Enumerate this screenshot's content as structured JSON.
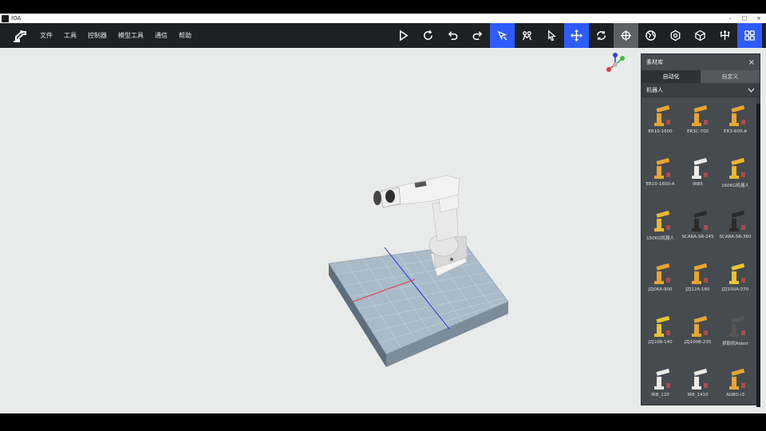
{
  "window": {
    "title": "IOA",
    "controls": [
      "–",
      "□",
      "×"
    ]
  },
  "menu": [
    "文件",
    "工具",
    "控制器",
    "模型工具",
    "通信",
    "帮助"
  ],
  "toolbar_icons": [
    "play-icon",
    "redo-circle-icon",
    "undo-icon",
    "redo-icon",
    "select-cursor-icon",
    "robot-arm-icon",
    "pointer-icon",
    "move-icon",
    "rotate-icon",
    "crosshair-icon",
    "globe-icon",
    "settings-icon",
    "cube-icon",
    "tree-icon",
    "grid-icon"
  ],
  "panel": {
    "title": "素材库",
    "close": "×",
    "tabs": [
      "自动化",
      "自定义"
    ],
    "active_tab": 0,
    "dropdown": "机器人",
    "items": [
      {
        "label": "ER10-1600",
        "color": "#e8a531"
      },
      {
        "label": "ER3C-700",
        "color": "#e8a531"
      },
      {
        "label": "ER3-600-A",
        "color": "#e8a531"
      },
      {
        "label": "ER10-1600-A",
        "color": "#e8a531"
      },
      {
        "label": "IRB5",
        "color": "#ecebe6"
      },
      {
        "label": "160KG机器人",
        "color": "#e8b82e"
      },
      {
        "label": "150KG机器人",
        "color": "#e8b82e"
      },
      {
        "label": "SCARA-SR-245",
        "color": "#2b2b2b"
      },
      {
        "label": "SCARA-SR-360",
        "color": "#2b2b2b"
      },
      {
        "label": "JZJ06A-900",
        "color": "#e8a531"
      },
      {
        "label": "JZJ12A-160",
        "color": "#e8a531"
      },
      {
        "label": "JZJ100A-370",
        "color": "#e8c42e"
      },
      {
        "label": "JZJ10B-140",
        "color": "#e8c42e"
      },
      {
        "label": "JZJ100B-235",
        "color": "#e8a531"
      },
      {
        "label": "抓取机Robot",
        "color": "#555555"
      },
      {
        "label": "IRB_120",
        "color": "#ecebe6"
      },
      {
        "label": "IRB_1410",
        "color": "#ecebe6"
      },
      {
        "label": "AUBO-i3",
        "color": "#e8a531"
      }
    ]
  }
}
